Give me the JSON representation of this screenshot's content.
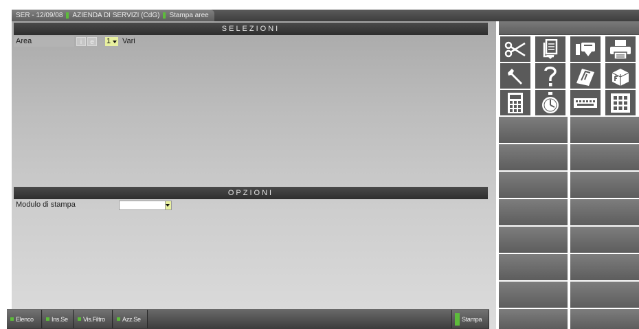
{
  "titlebar": {
    "company": "SER - 12/09/08",
    "module": "AZIENDA DI SERVIZI (CdG)",
    "screen": "Stampa aree"
  },
  "selezioni": {
    "header": "SELEZIONI",
    "area": {
      "label": "Area",
      "toggle_i": "i",
      "toggle_e": "e",
      "value": "1",
      "description": "Vari"
    }
  },
  "opzioni": {
    "header": "OPZIONI",
    "modulo_stampa": {
      "label": "Modulo di stampa",
      "value": ""
    }
  },
  "footer": {
    "buttons": [
      "Elenco",
      "Ins.Se",
      "Vis.Filtro",
      "Azz.Se"
    ],
    "stampa": "Stampa"
  },
  "toolbar": {
    "icons": [
      "scissors-icon",
      "copy-document-icon",
      "paste-icon",
      "printer-icon",
      "wrench-icon",
      "help-question-icon",
      "notes-icon",
      "function-keys-icon",
      "calculator-icon",
      "stopwatch-icon",
      "keyboard-icon",
      "grid-icon"
    ]
  },
  "colors": {
    "accent_green": "#5dbb3b",
    "header_dark": "#2e2e2e",
    "field_yellow": "#e8f0a0"
  }
}
